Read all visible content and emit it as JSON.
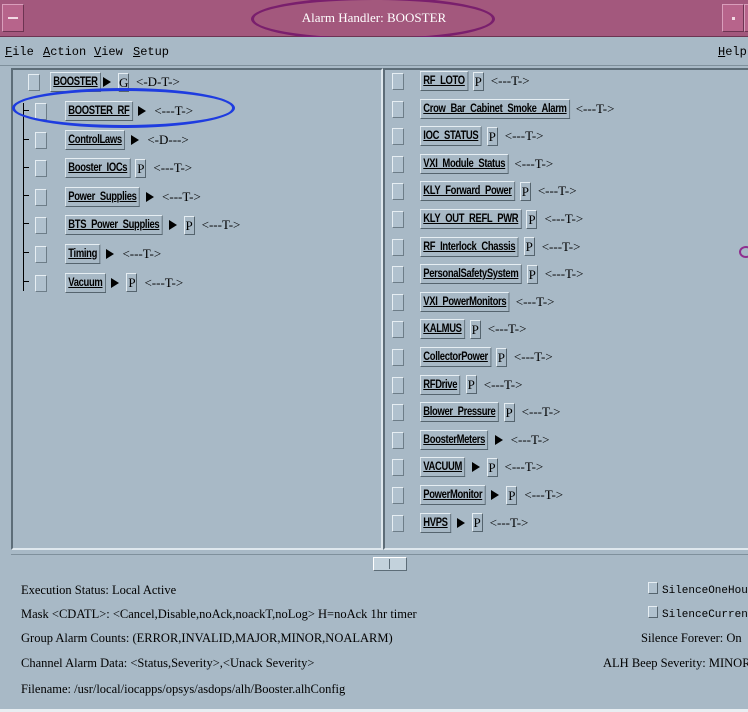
{
  "window": {
    "title": "Alarm Handler: BOOSTER"
  },
  "menubar": {
    "file": "File",
    "action": "Action",
    "view": "View",
    "setup": "Setup",
    "help": "Help"
  },
  "left_tree": {
    "root": {
      "label": "BOOSTER",
      "g": "G",
      "status": "<-D-T->"
    },
    "items": [
      {
        "label": "BOOSTER_RF",
        "arrow": true,
        "p": "",
        "status": "<---T->"
      },
      {
        "label": "ControlLaws",
        "arrow": true,
        "p": "",
        "status": "<-D--->"
      },
      {
        "label": "Booster_IOCs",
        "arrow": false,
        "p": "P",
        "status": "<---T->"
      },
      {
        "label": "Power_Supplies",
        "arrow": true,
        "p": "",
        "status": "<---T->"
      },
      {
        "label": "BTS_Power_Supplies",
        "arrow": true,
        "p": "P",
        "status": "<---T->"
      },
      {
        "label": "Timing",
        "arrow": true,
        "p": "",
        "status": "<---T->"
      },
      {
        "label": "Vacuum",
        "arrow": true,
        "p": "P",
        "status": "<---T->"
      }
    ]
  },
  "right_list": {
    "items": [
      {
        "label": "RF_LOTO",
        "arrow": false,
        "p": "P",
        "status": "<---T->"
      },
      {
        "label": "Crow_Bar_Cabinet_Smoke_Alarm",
        "arrow": false,
        "p": "",
        "status": "<---T->"
      },
      {
        "label": "IOC_STATUS",
        "arrow": false,
        "p": "P",
        "status": "<---T->"
      },
      {
        "label": "VXI_Module_Status",
        "arrow": false,
        "p": "",
        "status": "<---T->"
      },
      {
        "label": "KLY_Forward_Power",
        "arrow": false,
        "p": "P",
        "status": "<---T->"
      },
      {
        "label": "KLY_OUT_REFL_PWR",
        "arrow": false,
        "p": "P",
        "status": "<---T->"
      },
      {
        "label": "RF_Interlock_Chassis",
        "arrow": false,
        "p": "P",
        "status": "<---T->"
      },
      {
        "label": "PersonalSafetySystem",
        "arrow": false,
        "p": "P",
        "status": "<---T->"
      },
      {
        "label": "VXI_PowerMonitors",
        "arrow": false,
        "p": "",
        "status": "<---T->"
      },
      {
        "label": "KALMUS",
        "arrow": false,
        "p": "P",
        "status": "<---T->"
      },
      {
        "label": "CollectorPower",
        "arrow": false,
        "p": "P",
        "status": "<---T->"
      },
      {
        "label": "RFDrive",
        "arrow": false,
        "p": "P",
        "status": "<---T->"
      },
      {
        "label": "Blower_Pressure",
        "arrow": false,
        "p": "P",
        "status": "<---T->"
      },
      {
        "label": "BoosterMeters",
        "arrow": true,
        "p": "",
        "status": "<---T->"
      },
      {
        "label": "VACUUM",
        "arrow": true,
        "p": "P",
        "status": "<---T->"
      },
      {
        "label": "PowerMonitor",
        "arrow": true,
        "p": "P",
        "status": "<---T->"
      },
      {
        "label": "HVPS",
        "arrow": true,
        "p": "P",
        "status": "<---T->"
      }
    ]
  },
  "info": {
    "execution_status": "Execution Status:  Local Active",
    "mask": "Mask <CDATL>:  <Cancel,Disable,noAck,noackT,noLog>     H=noAck 1hr timer",
    "group_counts": "Group Alarm Counts:  (ERROR,INVALID,MAJOR,MINOR,NOALARM)",
    "channel_data": "Channel Alarm Data:  <Status,Severity>,<Unack Severity>",
    "filename": "Filename:   /usr/local/iocapps/opsys/asdops/alh/Booster.alhConfig",
    "silence_one_hour": "SilenceOneHour",
    "silence_current": "SilenceCurrent",
    "silence_forever": "Silence Forever:  On",
    "beep_severity": "ALH Beep Severity:  MINOR"
  },
  "colors": {
    "title_bar": "#a3587d",
    "background": "#a8b9c6",
    "annotation_purple": "#7a1f6d",
    "annotation_blue": "#1e3ce0"
  }
}
